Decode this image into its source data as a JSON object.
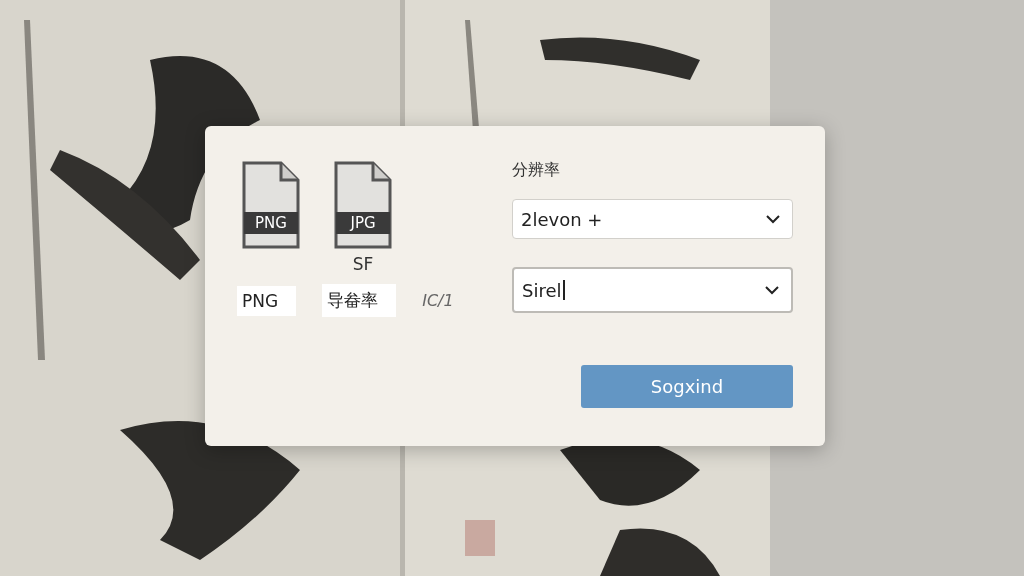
{
  "dialog": {
    "formats": [
      {
        "badge": "PNG"
      },
      {
        "badge": "JPG",
        "caption": "SF"
      }
    ],
    "options": [
      {
        "text": "PNG",
        "kind": "chip"
      },
      {
        "text": "导畚率",
        "kind": "chip"
      },
      {
        "text": "IC/1",
        "kind": "plain"
      }
    ],
    "resolution_label": "分辨率",
    "fields": [
      {
        "value": "2levon +",
        "focused": false
      },
      {
        "value": "Sirel",
        "focused": true
      }
    ],
    "button": "Sogxind"
  }
}
